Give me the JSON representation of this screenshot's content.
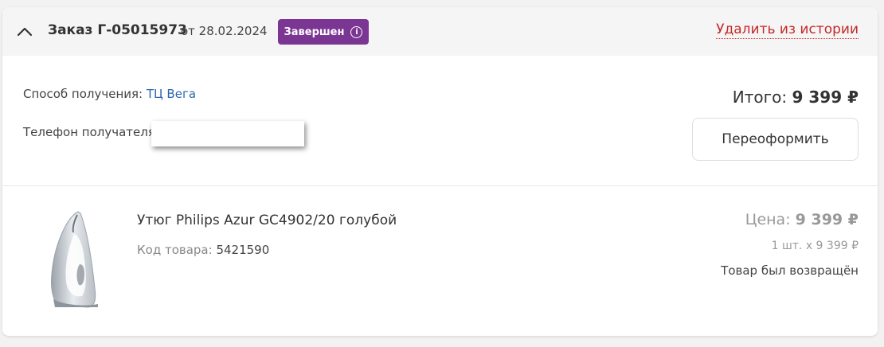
{
  "order": {
    "title": "Заказ Г-05015973",
    "date": "от 28.02.2024",
    "status_badge": "Завершен",
    "delete_link": "Удалить из истории"
  },
  "details": {
    "delivery_label": "Способ получения:",
    "delivery_value": "ТЦ Вега",
    "phone_label": "Телефон получателя:",
    "phone_value": "",
    "total_label": "Итого:",
    "total_value": "9 399 ₽",
    "reorder_button": "Переоформить"
  },
  "item": {
    "name": "Утюг Philips Azur GC4902/20 голубой",
    "code_label": "Код товара:",
    "code_value": "5421590",
    "price_label": "Цена:",
    "price_value": "9 399 ₽",
    "qty_text": "1 шт. x 9 399 ₽",
    "status_text": "Товар был возвращён"
  },
  "icons": {
    "collapse": "chevron-up-icon",
    "info": "info-icon",
    "product": "iron-image"
  },
  "colors": {
    "badge": "#7b3593",
    "delete_link": "#c62828",
    "link": "#2e66b4"
  }
}
